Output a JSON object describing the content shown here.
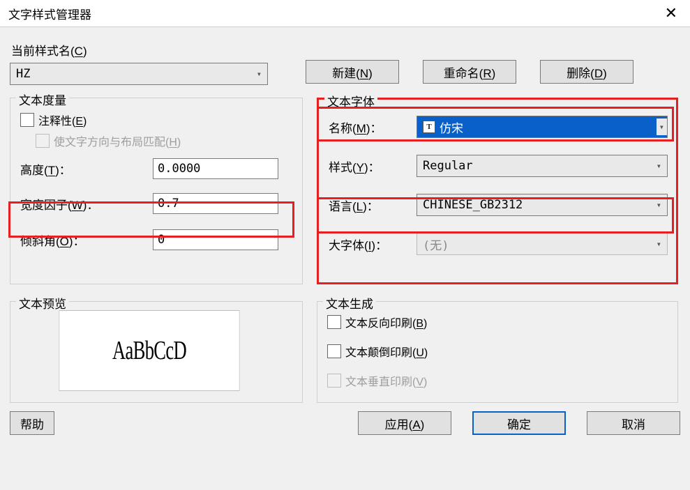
{
  "title": "文字样式管理器",
  "labels": {
    "current_style": "当前样式名(C)",
    "help": "帮助",
    "apply": "应用(A)",
    "ok": "确定",
    "cancel": "取消",
    "new": "新建(N)",
    "rename": "重命名(R)",
    "delete": "删除(D)"
  },
  "style_name": "HZ",
  "measure": {
    "legend": "文本度量",
    "annotative": "注释性(E)",
    "match_orientation": "使文字方向与布局匹配(H)",
    "height_label": "高度(T)：",
    "height_value": "0.0000",
    "width_label": "宽度因子(W)：",
    "width_value": "0.7",
    "oblique_label": "倾斜角(O)：",
    "oblique_value": "0"
  },
  "font": {
    "legend": "文本字体",
    "name_label": "名称(M)：",
    "name_value": "仿宋",
    "style_label": "样式(Y)：",
    "style_value": "Regular",
    "lang_label": "语言(L)：",
    "lang_value": "CHINESE_GB2312",
    "bigfont_label": "大字体(I)：",
    "bigfont_value": "(无)"
  },
  "preview": {
    "legend": "文本预览",
    "sample": "AaBbCcD"
  },
  "gen": {
    "legend": "文本生成",
    "backwards": "文本反向印刷(B)",
    "upside": "文本颠倒印刷(U)",
    "vertical": "文本垂直印刷(V)"
  }
}
